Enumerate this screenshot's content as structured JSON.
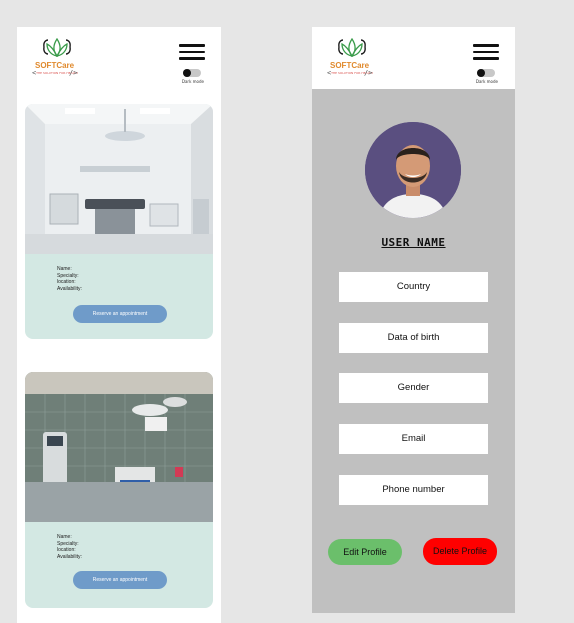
{
  "brand": {
    "name": "SOFTCare",
    "tagline": "THE SOLUTION FOR HEALTH",
    "bracket_left": "<",
    "bracket_right": "/>"
  },
  "header": {
    "toggle_label": "Dark mode",
    "menu_icon": "hamburger-menu-icon",
    "toggle_icon": "toggle-switch-icon"
  },
  "cards": [
    {
      "photo": "hospital-room-photo",
      "name_label": "Name:",
      "specialty_label": "Specialty:",
      "location_label": "location:",
      "availability_label": "Availability:",
      "button": "Reserve an appointment"
    },
    {
      "photo": "operating-room-photo",
      "name_label": "Name:",
      "specialty_label": "Specialty:",
      "location_label": "location:",
      "availability_label": "Availability:",
      "button": "Reserve an appointment"
    }
  ],
  "profile": {
    "user_name": "USER NAME",
    "fields": [
      "Country",
      "Data of birth",
      "Gender",
      "Email",
      "Phone number"
    ],
    "edit_button": "Edit Profile",
    "delete_button": "Delete Profile"
  },
  "colors": {
    "card_bg": "#d3e8e3",
    "button_blue": "#6f9bc9",
    "profile_bg": "#c0c0c0",
    "edit_green": "#6bbf6b",
    "delete_red": "#ff0000",
    "brand_orange": "#e08a2e"
  }
}
